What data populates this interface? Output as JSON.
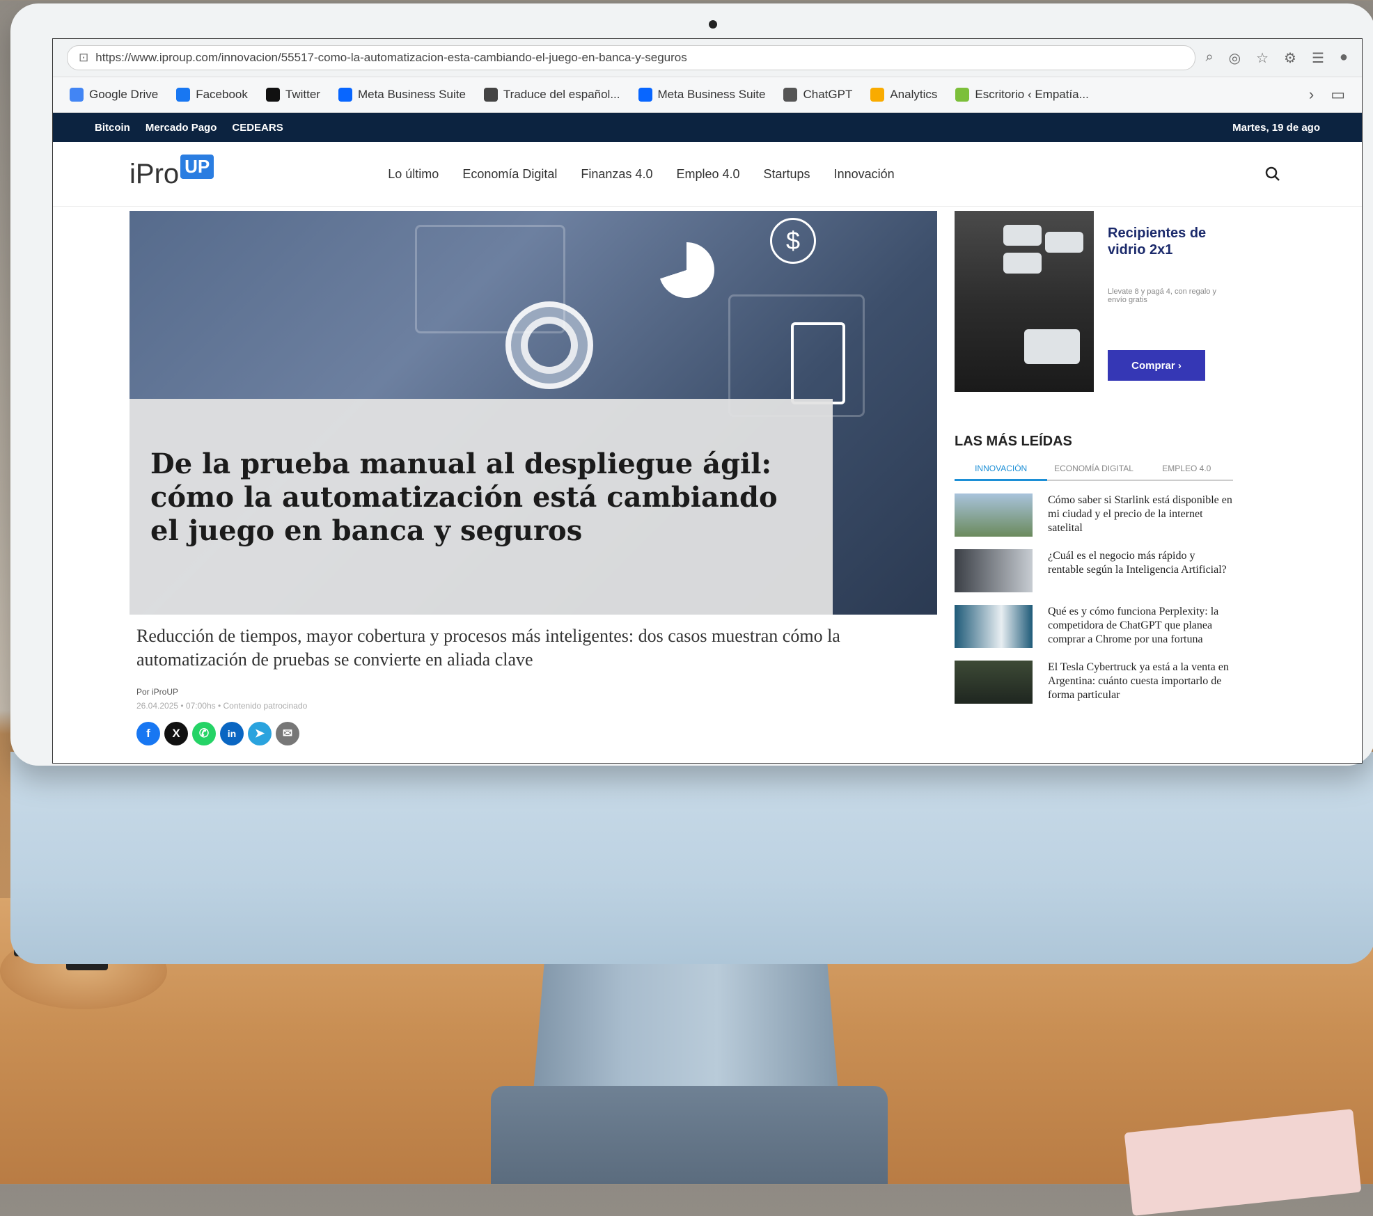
{
  "browser": {
    "url": "https://www.iproup.com/innovacion/55517-como-la-automatizacion-esta-cambiando-el-juego-en-banca-y-seguros",
    "bookmarks": [
      {
        "label": "Google Drive",
        "color": "#4285f4"
      },
      {
        "label": "Facebook",
        "color": "#1877f2"
      },
      {
        "label": "Twitter",
        "color": "#111111"
      },
      {
        "label": "Meta Business Suite",
        "color": "#0866ff"
      },
      {
        "label": "Traduce del español...",
        "color": "#444444"
      },
      {
        "label": "Meta Business Suite",
        "color": "#0866ff"
      },
      {
        "label": "ChatGPT",
        "color": "#555555"
      },
      {
        "label": "Analytics",
        "color": "#f9ab00"
      },
      {
        "label": "Escritorio ‹ Empatía...",
        "color": "#7cbf3a"
      }
    ]
  },
  "ticker": {
    "items": [
      "Bitcoin",
      "Mercado Pago",
      "CEDEARS"
    ],
    "date": "Martes, 19 de ago"
  },
  "site": {
    "logo_text": "iPro",
    "logo_badge": "UP",
    "nav": [
      "Lo último",
      "Economía Digital",
      "Finanzas 4.0",
      "Empleo 4.0",
      "Startups",
      "Innovación"
    ]
  },
  "article": {
    "title": "De la prueba manual al despliegue ágil: cómo la automatización está cambiando el juego en banca y seguros",
    "subtitle": "Reducción de tiempos, mayor cobertura y procesos más inteligentes: dos casos muestran cómo la automatización de pruebas se convierte en aliada clave",
    "author": "Por iProUP",
    "date": "26.04.2025 • 07:00hs • Contenido patrocinado",
    "hero_icon": "$",
    "share": [
      {
        "name": "facebook",
        "glyph": "f",
        "color": "#1877f2"
      },
      {
        "name": "x",
        "glyph": "X",
        "color": "#111111"
      },
      {
        "name": "whatsapp",
        "glyph": "✆",
        "color": "#25d366"
      },
      {
        "name": "linkedin",
        "glyph": "in",
        "color": "#0a66c2"
      },
      {
        "name": "telegram",
        "glyph": "➤",
        "color": "#2aa3de"
      },
      {
        "name": "email",
        "glyph": "✉",
        "color": "#777777"
      }
    ]
  },
  "ad": {
    "title": "Recipientes de vidrio 2x1",
    "desc": "Llevate 8 y pagá 4, con regalo y envío gratis",
    "button": "Comprar ›"
  },
  "mas_leidas": {
    "title": "LAS MÁS LEÍDAS",
    "tabs": [
      "INNOVACIÓN",
      "ECONOMÍA DIGITAL",
      "EMPLEO 4.0"
    ],
    "items": [
      {
        "title": "Cómo saber si Starlink está disponible en mi ciudad y el precio de la internet satelital",
        "thumb_color": "#6b8a5c"
      },
      {
        "title": "¿Cuál es el negocio más rápido y rentable según la Inteligencia Artificial?",
        "thumb_color": "#8a8f96"
      },
      {
        "title": "Qué es y cómo funciona Perplexity: la competidora de ChatGPT que planea comprar a Chrome por una fortuna",
        "thumb_color": "#2f6e8a"
      },
      {
        "title": "El Tesla Cybertruck ya está a la venta en Argentina: cuánto cuesta importarlo de forma particular",
        "thumb_color": "#3d4a36"
      }
    ]
  }
}
